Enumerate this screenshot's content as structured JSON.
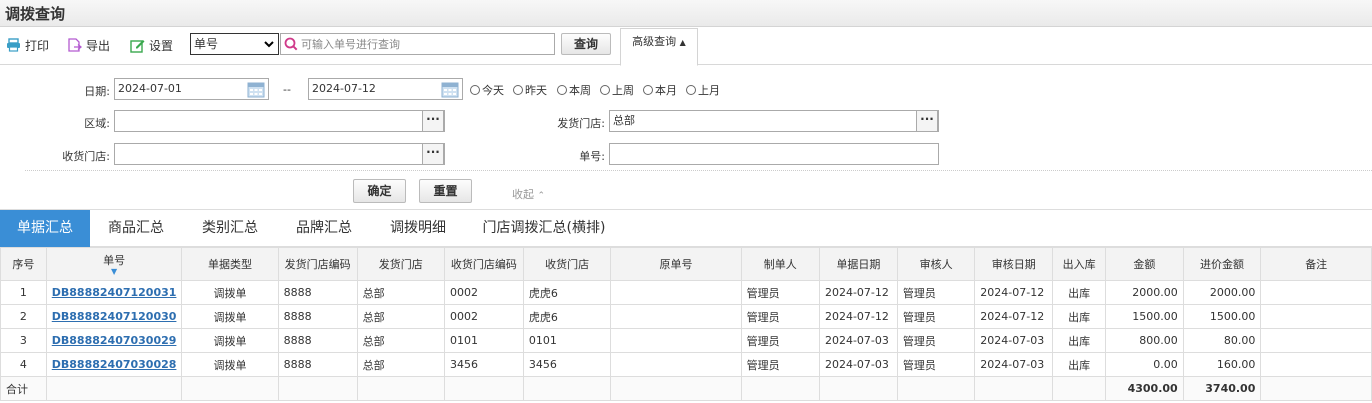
{
  "page_title": "调拨查询",
  "toolbar": {
    "print": "打印",
    "export": "导出",
    "settings": "设置",
    "field_select": "单号",
    "search_placeholder": "可输入单号进行查询",
    "query": "查询",
    "advanced": "高级查询"
  },
  "filter": {
    "date_label": "日期:",
    "date_from": "2024-07-01",
    "date_sep": "--",
    "date_to": "2024-07-12",
    "quick": [
      "今天",
      "昨天",
      "本周",
      "上周",
      "本月",
      "上月"
    ],
    "region_label": "区域:",
    "region_value": "",
    "ship_store_label": "发货门店:",
    "ship_store_value": "总部",
    "recv_store_label": "收货门店:",
    "recv_store_value": "",
    "order_no_label": "单号:",
    "order_no_value": "",
    "confirm": "确定",
    "reset": "重置",
    "collapse": "收起"
  },
  "tabs": [
    "单据汇总",
    "商品汇总",
    "类别汇总",
    "品牌汇总",
    "调拨明细",
    "门店调拨汇总(横排)"
  ],
  "table": {
    "headers": [
      "序号",
      "单号",
      "单据类型",
      "发货门店编码",
      "发货门店",
      "收货门店编码",
      "收货门店",
      "原单号",
      "制单人",
      "单据日期",
      "审核人",
      "审核日期",
      "出入库",
      "金额",
      "进价金额",
      "备注"
    ],
    "rows": [
      [
        "1",
        "DB88882407120031",
        "调拨单",
        "8888",
        "总部",
        "0002",
        "虎虎6",
        "",
        "管理员",
        "2024-07-12",
        "管理员",
        "2024-07-12",
        "出库",
        "2000.00",
        "2000.00",
        ""
      ],
      [
        "2",
        "DB88882407120030",
        "调拨单",
        "8888",
        "总部",
        "0002",
        "虎虎6",
        "",
        "管理员",
        "2024-07-12",
        "管理员",
        "2024-07-12",
        "出库",
        "1500.00",
        "1500.00",
        ""
      ],
      [
        "3",
        "DB88882407030029",
        "调拨单",
        "8888",
        "总部",
        "0101",
        "0101",
        "",
        "管理员",
        "2024-07-03",
        "管理员",
        "2024-07-03",
        "出库",
        "800.00",
        "80.00",
        ""
      ],
      [
        "4",
        "DB88882407030028",
        "调拨单",
        "8888",
        "总部",
        "3456",
        "3456",
        "",
        "管理员",
        "2024-07-03",
        "管理员",
        "2024-07-03",
        "出库",
        "0.00",
        "160.00",
        ""
      ]
    ],
    "total_label": "合计",
    "total_amount": "4300.00",
    "total_cost": "3740.00"
  },
  "colors": {
    "accent": "#3a8ed6",
    "link": "#2d6eb0"
  }
}
